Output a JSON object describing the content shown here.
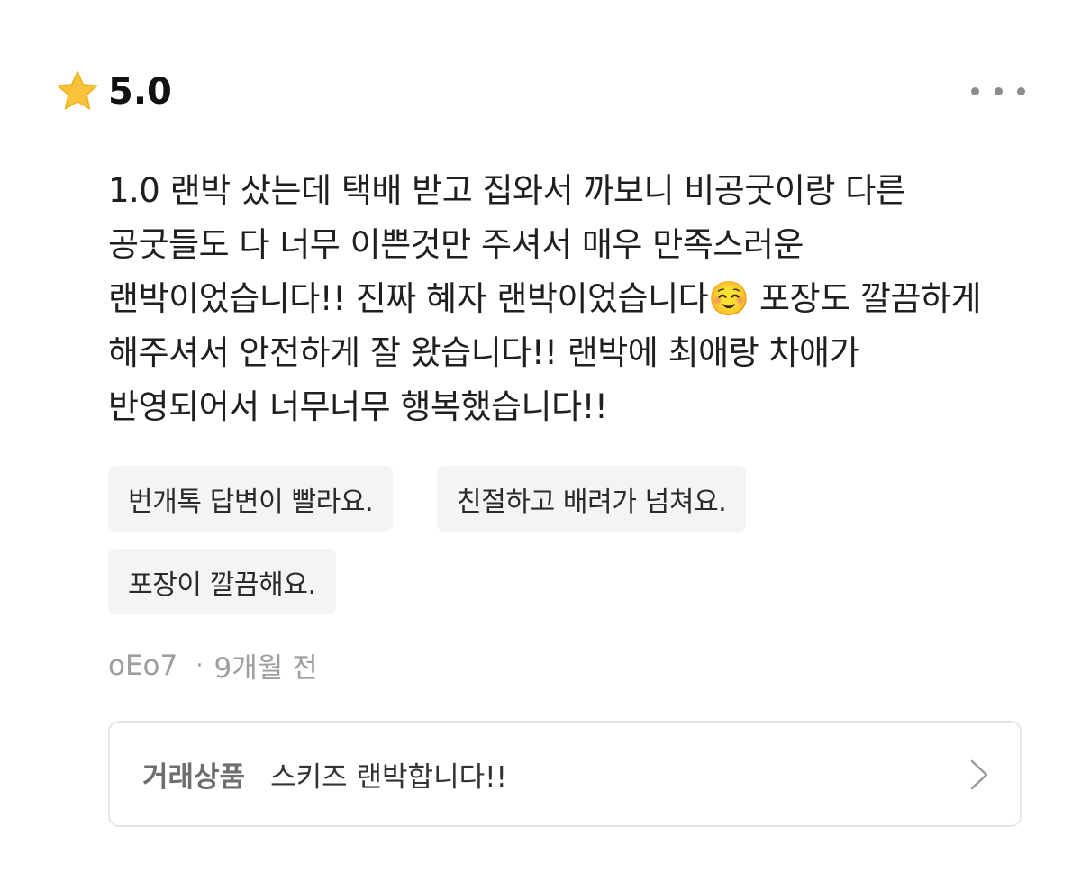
{
  "rating": {
    "icon": "star-icon",
    "value": "5.0"
  },
  "menu": {
    "icon": "more-horizontal-icon"
  },
  "review": {
    "text": "1.0 랜박 샀는데 택배 받고 집와서 까보니 비공굿이랑 다른 공굿들도 다 너무 이쁜것만 주셔서 매우 만족스러운 랜박이었습니다!! 진짜 혜자 랜박이었습니다☺️ 포장도 깔끔하게 해주셔서 안전하게 잘 왔습니다!! 랜박에 최애랑 차애가 반영되어서 너무너무 행복했습니다!!"
  },
  "tags": [
    {
      "label": "번개톡 답변이 빨라요."
    },
    {
      "label": "친절하고 배려가 넘쳐요."
    },
    {
      "label": "포장이 깔끔해요."
    }
  ],
  "meta": {
    "author": "oEo7",
    "separator": "·",
    "time": "9개월 전"
  },
  "product": {
    "label": "거래상품",
    "name": "스키즈 랜박합니다!!",
    "icon": "chevron-right-icon"
  },
  "colors": {
    "star": "#F7C33B",
    "tag_background": "#F4F4F4",
    "meta_text": "#9E9E9E",
    "card_border": "#E6E6E6"
  }
}
